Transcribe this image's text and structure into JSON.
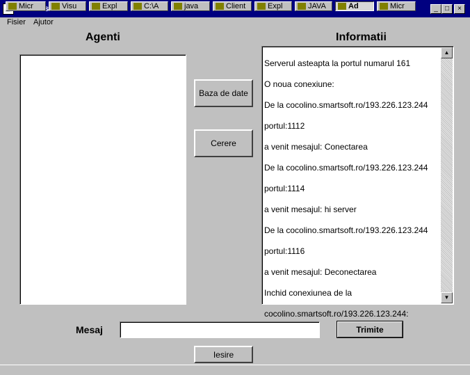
{
  "window": {
    "title": "Administrator",
    "minimize": "_",
    "maximize": "□",
    "close": "×"
  },
  "menu": [
    "Fisier",
    "Ajutor"
  ],
  "left_panel": {
    "title": "Agenti"
  },
  "right_panel": {
    "title": "Informatii",
    "log": [
      "Serverul asteapta la portul numarul 161",
      "O noua conexiune:",
      "De la cocolino.smartsoft.ro/193.226.123.244",
      "portul:1112",
      "a venit mesajul: Conectarea",
      "De la cocolino.smartsoft.ro/193.226.123.244",
      "portul:1114",
      "a venit mesajul: hi server",
      "De la cocolino.smartsoft.ro/193.226.123.244",
      "portul:1116",
      "a venit mesajul: Deconectarea",
      "Inchid conexiunea de la",
      "cocolino.smartsoft.ro/193.226.123.244:"
    ]
  },
  "buttons": {
    "database": "Baza de date",
    "request": "Cerere",
    "send": "Trimite",
    "exit": "Iesire"
  },
  "message": {
    "label": "Mesaj",
    "value": ""
  },
  "scrollbar": {
    "up": "▲",
    "down": "▼"
  },
  "taskbar": [
    "Micr",
    "Visu",
    "Expl",
    "C:\\A",
    "java",
    "Client",
    "Expl",
    "JAVA",
    "Ad",
    "Micr"
  ],
  "colors": {
    "titlebar": "#000080",
    "face": "#c0c0c0",
    "field": "#ffffff"
  }
}
